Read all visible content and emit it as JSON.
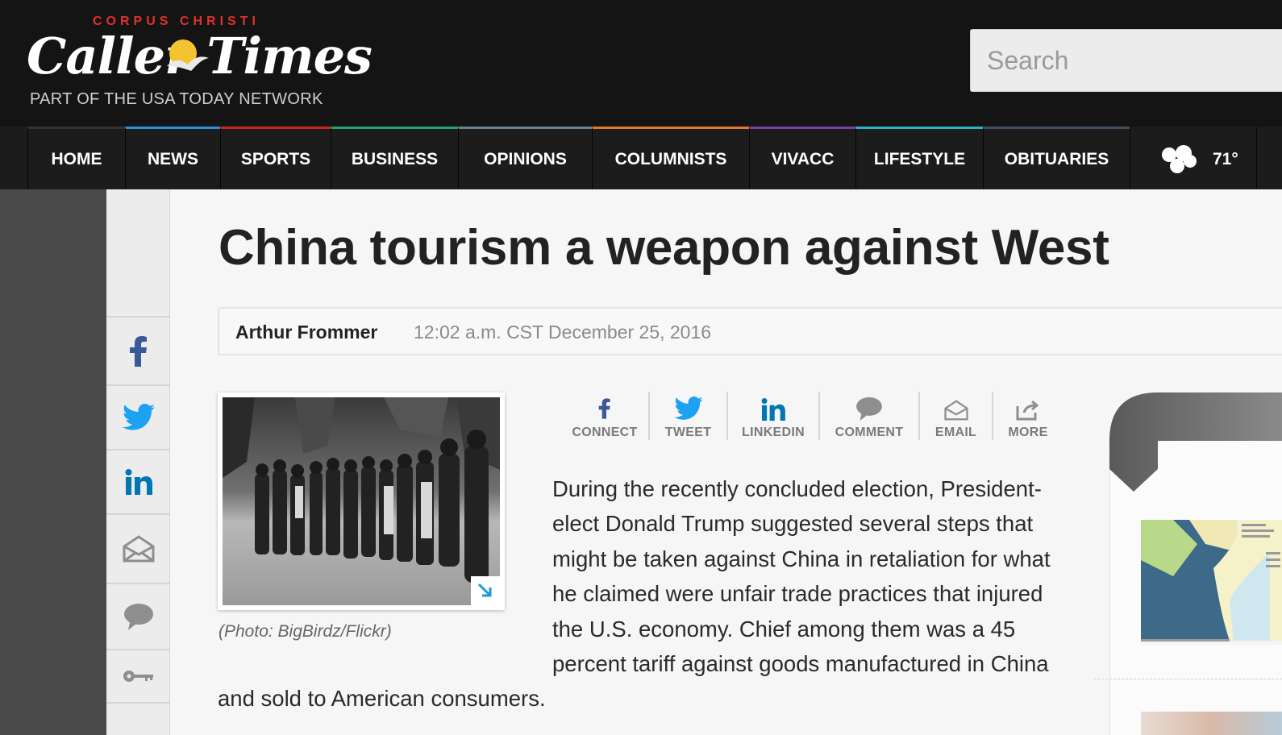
{
  "masthead": {
    "logo_top": "CORPUS CHRISTI",
    "logo_main": "Caller Times",
    "logo_sub": "PART OF THE USA TODAY NETWORK"
  },
  "search": {
    "placeholder": "Search"
  },
  "nav": {
    "items": [
      {
        "label": "HOME",
        "color": "#333333"
      },
      {
        "label": "NEWS",
        "color": "#2e8fd6"
      },
      {
        "label": "SPORTS",
        "color": "#c8291f"
      },
      {
        "label": "BUSINESS",
        "color": "#24a26a"
      },
      {
        "label": "OPINIONS",
        "color": "#6b7f8e"
      },
      {
        "label": "COLUMNISTS",
        "color": "#e6762a"
      },
      {
        "label": "VIVACC",
        "color": "#7a3fa0"
      },
      {
        "label": "LIFESTYLE",
        "color": "#2bb3c6"
      },
      {
        "label": "OBITUARIES",
        "color": "#3f4f5f"
      }
    ],
    "weather": {
      "icon": "cloud-icon",
      "temp": "71°"
    }
  },
  "rail": {
    "buttons": [
      "facebook-icon",
      "twitter-icon",
      "linkedin-icon",
      "email-icon",
      "comment-icon",
      "key-icon"
    ]
  },
  "article": {
    "headline": "China tourism a weapon against West",
    "author": "Arthur Frommer",
    "timestamp": "12:02 a.m. CST December 25, 2016",
    "photo_caption": "(Photo: BigBirdz/Flickr)",
    "body_main": "During the recently concluded election, President-elect Donald Trump suggested several steps that might be taken against China in retaliation for what he claimed were unfair trade practices that injured the U.S. economy. Chief among them was a 45 percent tariff against goods manufactured in China",
    "body_wrap": "and sold to American consumers."
  },
  "share": {
    "items": [
      {
        "label": "CONNECT",
        "icon": "facebook-icon"
      },
      {
        "label": "TWEET",
        "icon": "twitter-icon"
      },
      {
        "label": "LINKEDIN",
        "icon": "linkedin-icon"
      },
      {
        "label": "COMMENT",
        "icon": "comment-icon"
      },
      {
        "label": "EMAIL",
        "icon": "email-icon"
      },
      {
        "label": "MORE",
        "icon": "share-icon"
      }
    ]
  },
  "colors": {
    "facebook": "#3b5998",
    "twitter": "#1da1f2",
    "linkedin": "#0077b5",
    "logo_red": "#e0312a"
  }
}
